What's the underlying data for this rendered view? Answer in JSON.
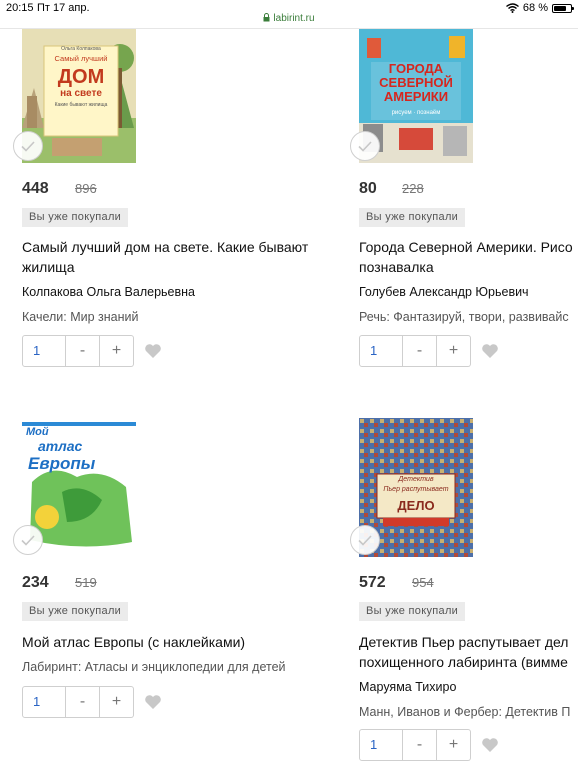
{
  "status": {
    "time": "20:15",
    "date": "Пт 17 апр.",
    "url": "labirint.ru",
    "battery": "68 %"
  },
  "labels": {
    "bought": "Вы уже покупали",
    "minus": "-",
    "plus": "+"
  },
  "products": [
    {
      "cover_title_author": "Ольга Колпакова",
      "cover_title_top": "Самый лучший",
      "cover_title_main": "ДОМ",
      "cover_title_sub": "на свете",
      "cover_title_foot": "Какие бывают жилища",
      "price": "448",
      "old_price": "896",
      "title_line1": "Самый лучший дом на свете. Какие бывают",
      "title_line2": "жилища",
      "author": "Колпакова Ольга Валерьевна",
      "publisher": "Качели: Мир знаний",
      "qty": "1"
    },
    {
      "cover_title_main": "ГОРОДА СЕВЕРНОЙ АМЕРИКИ",
      "cover_title_sub": "рисуем · познаём",
      "price": "80",
      "old_price": "228",
      "title_line1": "Города Северной Америки. Рисо",
      "title_line2": "познавалка",
      "author": "Голубев Александр Юрьевич",
      "publisher": "Речь: Фантазируй, твори, развивайс",
      "qty": "1"
    },
    {
      "cover_title_top": "Мой",
      "cover_title_main": "атлас",
      "cover_title_sub": "Европы",
      "price": "234",
      "old_price": "519",
      "title_line1": "Мой атлас Европы (с наклейками)",
      "title_line2": "",
      "author": "",
      "publisher": "Лабиринт: Атласы и энциклопедии для детей",
      "qty": "1"
    },
    {
      "cover_title_top": "Детектив",
      "cover_title_main": "Пьер распутывает",
      "cover_title_sub": "ДЕЛО",
      "price": "572",
      "old_price": "954",
      "title_line1": "Детектив Пьер распутывает дел",
      "title_line2": "похищенного лабиринта (вимме",
      "author": "Маруяма Тихиро",
      "publisher": "Манн, Иванов и Фербер: Детектив П",
      "qty": "1"
    }
  ]
}
